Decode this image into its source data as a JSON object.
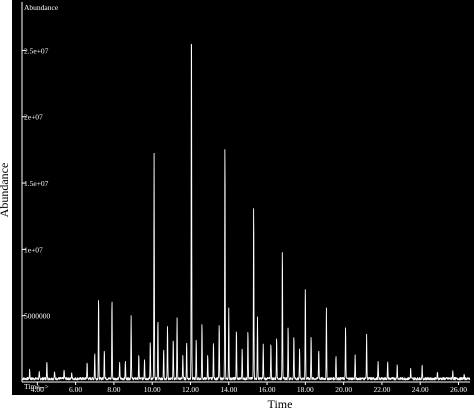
{
  "chart_data": {
    "type": "line",
    "title": "",
    "xlabel": "Time",
    "ylabel": "Abundance",
    "inner_ylabel": "Abundance",
    "x_axis_prefix": "Time-->",
    "xlim": [
      3.2,
      26.6
    ],
    "ylim": [
      0,
      28500000
    ],
    "x_ticks": [
      4.0,
      6.0,
      8.0,
      10.0,
      12.0,
      14.0,
      16.0,
      18.0,
      20.0,
      22.0,
      24.0,
      26.0
    ],
    "x_tick_labels": [
      "4.00",
      "6.00",
      "8.00",
      "10.00",
      "12.00",
      "14.00",
      "16.00",
      "18.00",
      "20.00",
      "22.00",
      "24.00",
      "26.00"
    ],
    "y_ticks": [
      5000000,
      10000000,
      15000000,
      20000000,
      25000000
    ],
    "y_tick_labels": [
      "5000000",
      "1e+07",
      "1.5e+07",
      "2e+07",
      "2.5e+07"
    ],
    "grid": false,
    "colors": {
      "background": "#000000",
      "trace": "#ffffff",
      "page": "#ffffff"
    },
    "baseline": 250000,
    "series": [
      {
        "peaks": [
          [
            3.6,
            900000
          ],
          [
            4.1,
            700000
          ],
          [
            4.5,
            1500000
          ],
          [
            4.9,
            800000
          ],
          [
            5.4,
            900000
          ],
          [
            5.8,
            700000
          ],
          [
            6.6,
            1500000
          ],
          [
            7.0,
            2200000
          ],
          [
            7.2,
            6400000
          ],
          [
            7.5,
            2500000
          ],
          [
            7.9,
            6400000
          ],
          [
            8.3,
            1500000
          ],
          [
            8.6,
            1600000
          ],
          [
            8.9,
            5000000
          ],
          [
            9.3,
            2000000
          ],
          [
            9.6,
            1800000
          ],
          [
            9.9,
            3000000
          ],
          [
            10.1,
            17200000
          ],
          [
            10.3,
            4800000
          ],
          [
            10.6,
            2500000
          ],
          [
            10.8,
            4300000
          ],
          [
            11.1,
            3200000
          ],
          [
            11.3,
            4800000
          ],
          [
            11.6,
            2000000
          ],
          [
            11.8,
            3000000
          ],
          [
            12.05,
            28500000
          ],
          [
            12.3,
            3200000
          ],
          [
            12.6,
            4500000
          ],
          [
            12.9,
            2000000
          ],
          [
            13.2,
            3000000
          ],
          [
            13.5,
            4500000
          ],
          [
            13.8,
            18300000
          ],
          [
            14.0,
            5500000
          ],
          [
            14.4,
            4000000
          ],
          [
            14.7,
            2500000
          ],
          [
            15.0,
            4000000
          ],
          [
            15.3,
            13800000
          ],
          [
            15.5,
            5000000
          ],
          [
            15.8,
            2800000
          ],
          [
            16.2,
            3000000
          ],
          [
            16.5,
            3500000
          ],
          [
            16.8,
            10300000
          ],
          [
            17.1,
            4200000
          ],
          [
            17.4,
            3600000
          ],
          [
            17.7,
            2500000
          ],
          [
            18.0,
            7300000
          ],
          [
            18.3,
            3500000
          ],
          [
            18.7,
            2500000
          ],
          [
            19.1,
            5500000
          ],
          [
            19.6,
            2000000
          ],
          [
            20.1,
            4200000
          ],
          [
            20.6,
            2000000
          ],
          [
            21.2,
            3500000
          ],
          [
            21.8,
            1500000
          ],
          [
            22.3,
            1500000
          ],
          [
            22.8,
            1300000
          ],
          [
            23.5,
            1000000
          ],
          [
            24.1,
            1200000
          ],
          [
            24.9,
            700000
          ],
          [
            25.7,
            800000
          ],
          [
            26.3,
            600000
          ]
        ]
      }
    ]
  }
}
